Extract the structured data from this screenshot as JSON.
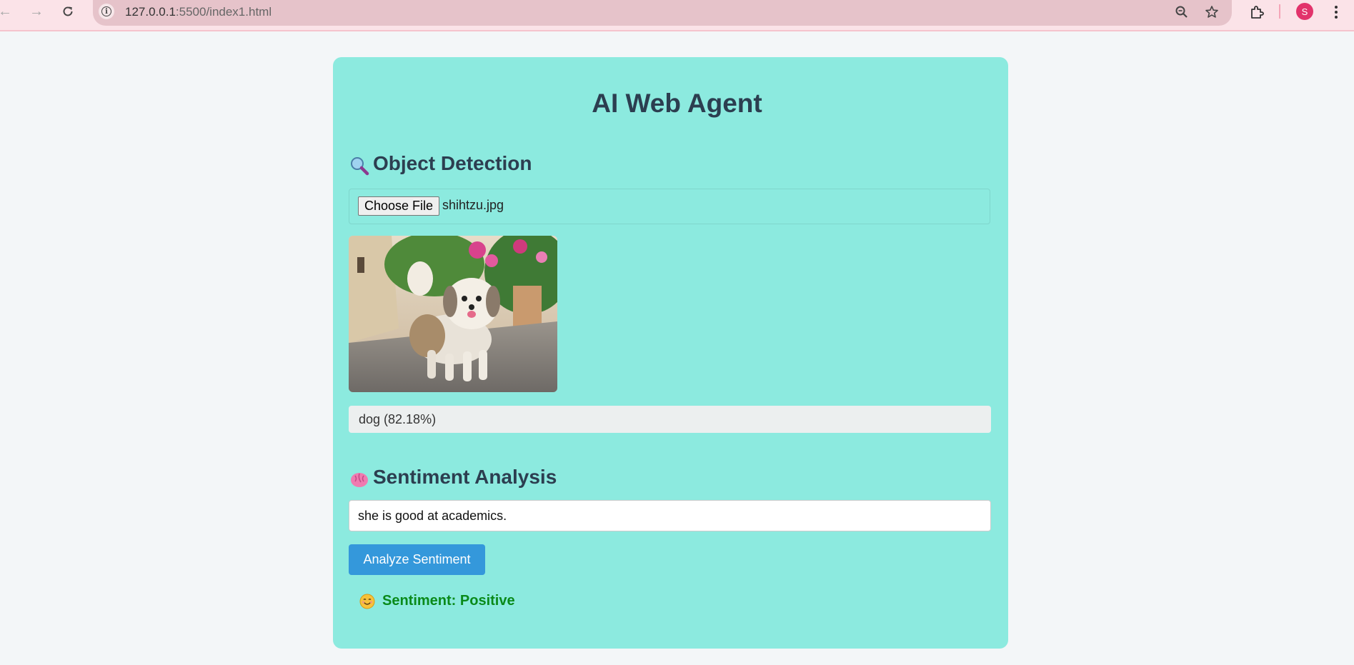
{
  "browser": {
    "url_host": "127.0.0.1",
    "url_path": ":5500/index1.html",
    "avatar_letter": "S"
  },
  "app": {
    "title": "AI Web Agent"
  },
  "object_detection": {
    "heading": "Object Detection",
    "heading_icon": "magnifier-icon",
    "file_button_label": "Choose File",
    "file_name": "shihtzu.jpg",
    "result": "dog (82.18%)"
  },
  "sentiment": {
    "heading": "Sentiment Analysis",
    "heading_icon": "brain-icon",
    "input_value": "she is good at academics.",
    "button_label": "Analyze Sentiment",
    "result": "Sentiment: Positive",
    "result_icon": "smiling-face-icon",
    "result_color": "#0a8a1a"
  },
  "colors": {
    "card": "#8ceadf",
    "heading": "#2c3e50",
    "button": "#3498db",
    "chrome": "#fbe3e8"
  }
}
